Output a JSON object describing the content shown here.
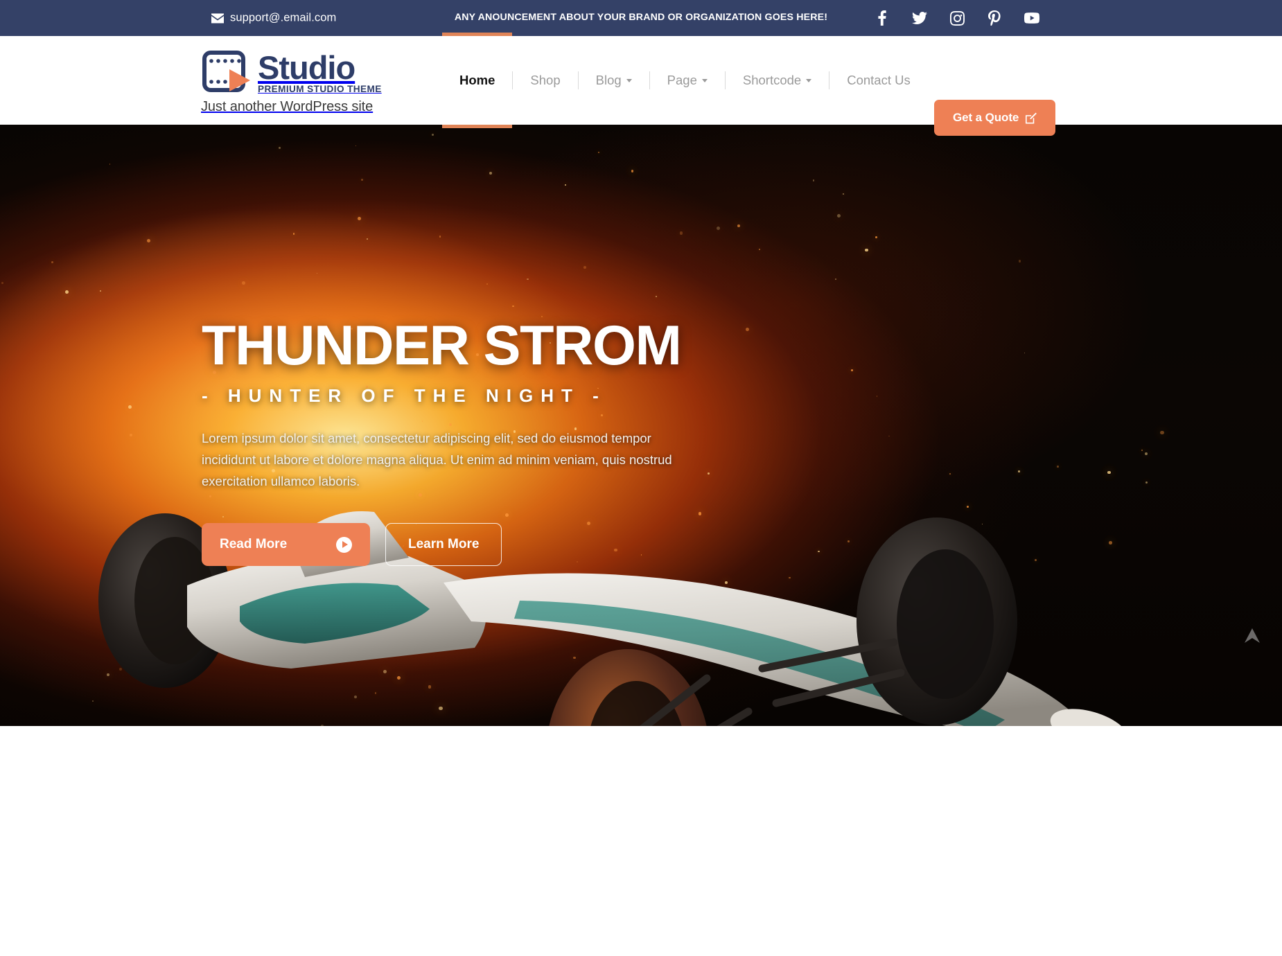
{
  "topbar": {
    "email": "support@.email.com",
    "email_icon": "envelope-icon",
    "announcement": "ANY ANOUNCEMENT ABOUT YOUR BRAND OR ORGANIZATION GOES HERE!",
    "background_color": "#344167",
    "social": [
      {
        "name": "facebook-icon",
        "label": "Facebook"
      },
      {
        "name": "twitter-icon",
        "label": "Twitter"
      },
      {
        "name": "instagram-icon",
        "label": "Instagram"
      },
      {
        "name": "pinterest-icon",
        "label": "Pinterest"
      },
      {
        "name": "youtube-icon",
        "label": "YouTube"
      }
    ]
  },
  "header": {
    "logo": {
      "icon": "film-strip-play-icon",
      "name": "Studio",
      "tagline": "PREMIUM STUDIO THEME",
      "site_description": "Just another WordPress site",
      "color": "#2e3d68",
      "accent": "#ee8055"
    },
    "nav": [
      {
        "label": "Home",
        "active": true,
        "dropdown": false
      },
      {
        "label": "Shop",
        "active": false,
        "dropdown": false
      },
      {
        "label": "Blog",
        "active": false,
        "dropdown": true
      },
      {
        "label": "Page",
        "active": false,
        "dropdown": true
      },
      {
        "label": "Shortcode",
        "active": false,
        "dropdown": true
      },
      {
        "label": "Contact Us",
        "active": false,
        "dropdown": false
      }
    ],
    "cta": {
      "label": "Get a Quote",
      "icon": "pencil-square-icon",
      "background_color": "#ee8055"
    }
  },
  "hero": {
    "title": "THUNDER STROM",
    "subtitle": "- HUNTER OF THE NIGHT -",
    "paragraph": "Lorem ipsum dolor sit amet, consectetur adipiscing elit, sed do eiusmod tempor incididunt ut labore et dolore magna aliqua. Ut enim ad minim veniam, quis nostrud exercitation ullamco laboris.",
    "primary_button": {
      "label": "Read More",
      "icon": "play-circle-icon",
      "background_color": "#ee8055"
    },
    "secondary_button": {
      "label": "Learn More",
      "style": "outline"
    },
    "background_image": "formula-one-race-car-with-fire-explosion",
    "scroll_indicator": "scroll-up-arrow-icon"
  },
  "theme": {
    "navy": "#344167",
    "orange": "#ee8055",
    "white": "#ffffff",
    "muted_nav": "#9a9a9a"
  }
}
